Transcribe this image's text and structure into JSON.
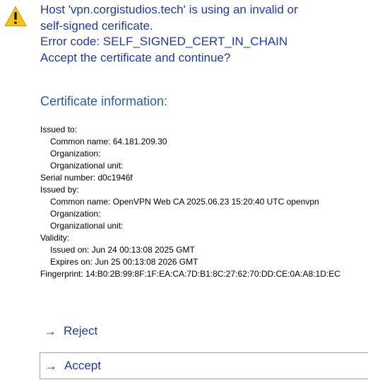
{
  "dialog": {
    "warning_icon": "warning-triangle-icon",
    "message_lines": [
      "Host 'vpn.corgistudios.tech' is using an invalid or",
      "self-signed cerificate.",
      "Error code: SELF_SIGNED_CERT_IN_CHAIN",
      "Accept the certificate and continue?"
    ],
    "section_title": "Certificate information:",
    "details": [
      "Issued to:",
      "Common name: 64.181.209.30",
      "Organization:",
      "Organizational unit:",
      "Serial number: d0c1946f",
      "Issued by:",
      "Common name: OpenVPN Web CA 2025.06.23 15:20:40 UTC openvpn",
      "Organization:",
      "Organizational unit:",
      "Validity:",
      "Issued on: Jun 24 00:13:08 2025 GMT",
      "Expires on: Jun 25 00:13:08 2026 GMT",
      "Fingerprint: 14:B0:2B:99:8F:1F:EA:CA:7D:B1:8C:27:62:70:DD:CE:0A:A8:1D:EC"
    ],
    "buttons": {
      "reject_label": "Reject",
      "accept_label": "Accept",
      "arrow_icon": "arrow-right-icon",
      "arrow_glyph": "→"
    },
    "colors": {
      "link_blue": "#1f3a9a",
      "title_blue": "#1f5fa8",
      "warning_yellow": "#f6c21c"
    }
  }
}
